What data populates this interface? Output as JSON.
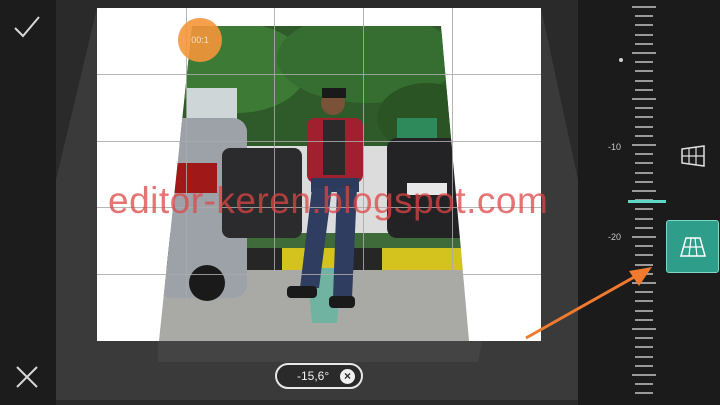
{
  "toolbar": {
    "confirm_icon": "checkmark-icon",
    "cancel_icon": "close-icon"
  },
  "canvas": {
    "watermark": "editor-keren.blogspot.com",
    "handle_label": "00:1"
  },
  "value_pill": {
    "value": "-15,6°",
    "clear_icon": "clear-icon"
  },
  "ruler": {
    "labels": [
      "-10",
      "-20"
    ],
    "current_value": -15.6
  },
  "modes": {
    "horizontal_icon": "horizontal-perspective-icon",
    "vertical_icon": "vertical-perspective-icon",
    "selected": "vertical"
  },
  "colors": {
    "accent": "#2e9d8a",
    "indicator": "#5fd8c5",
    "arrow": "#f07a2d",
    "handle": "#f4963a"
  }
}
